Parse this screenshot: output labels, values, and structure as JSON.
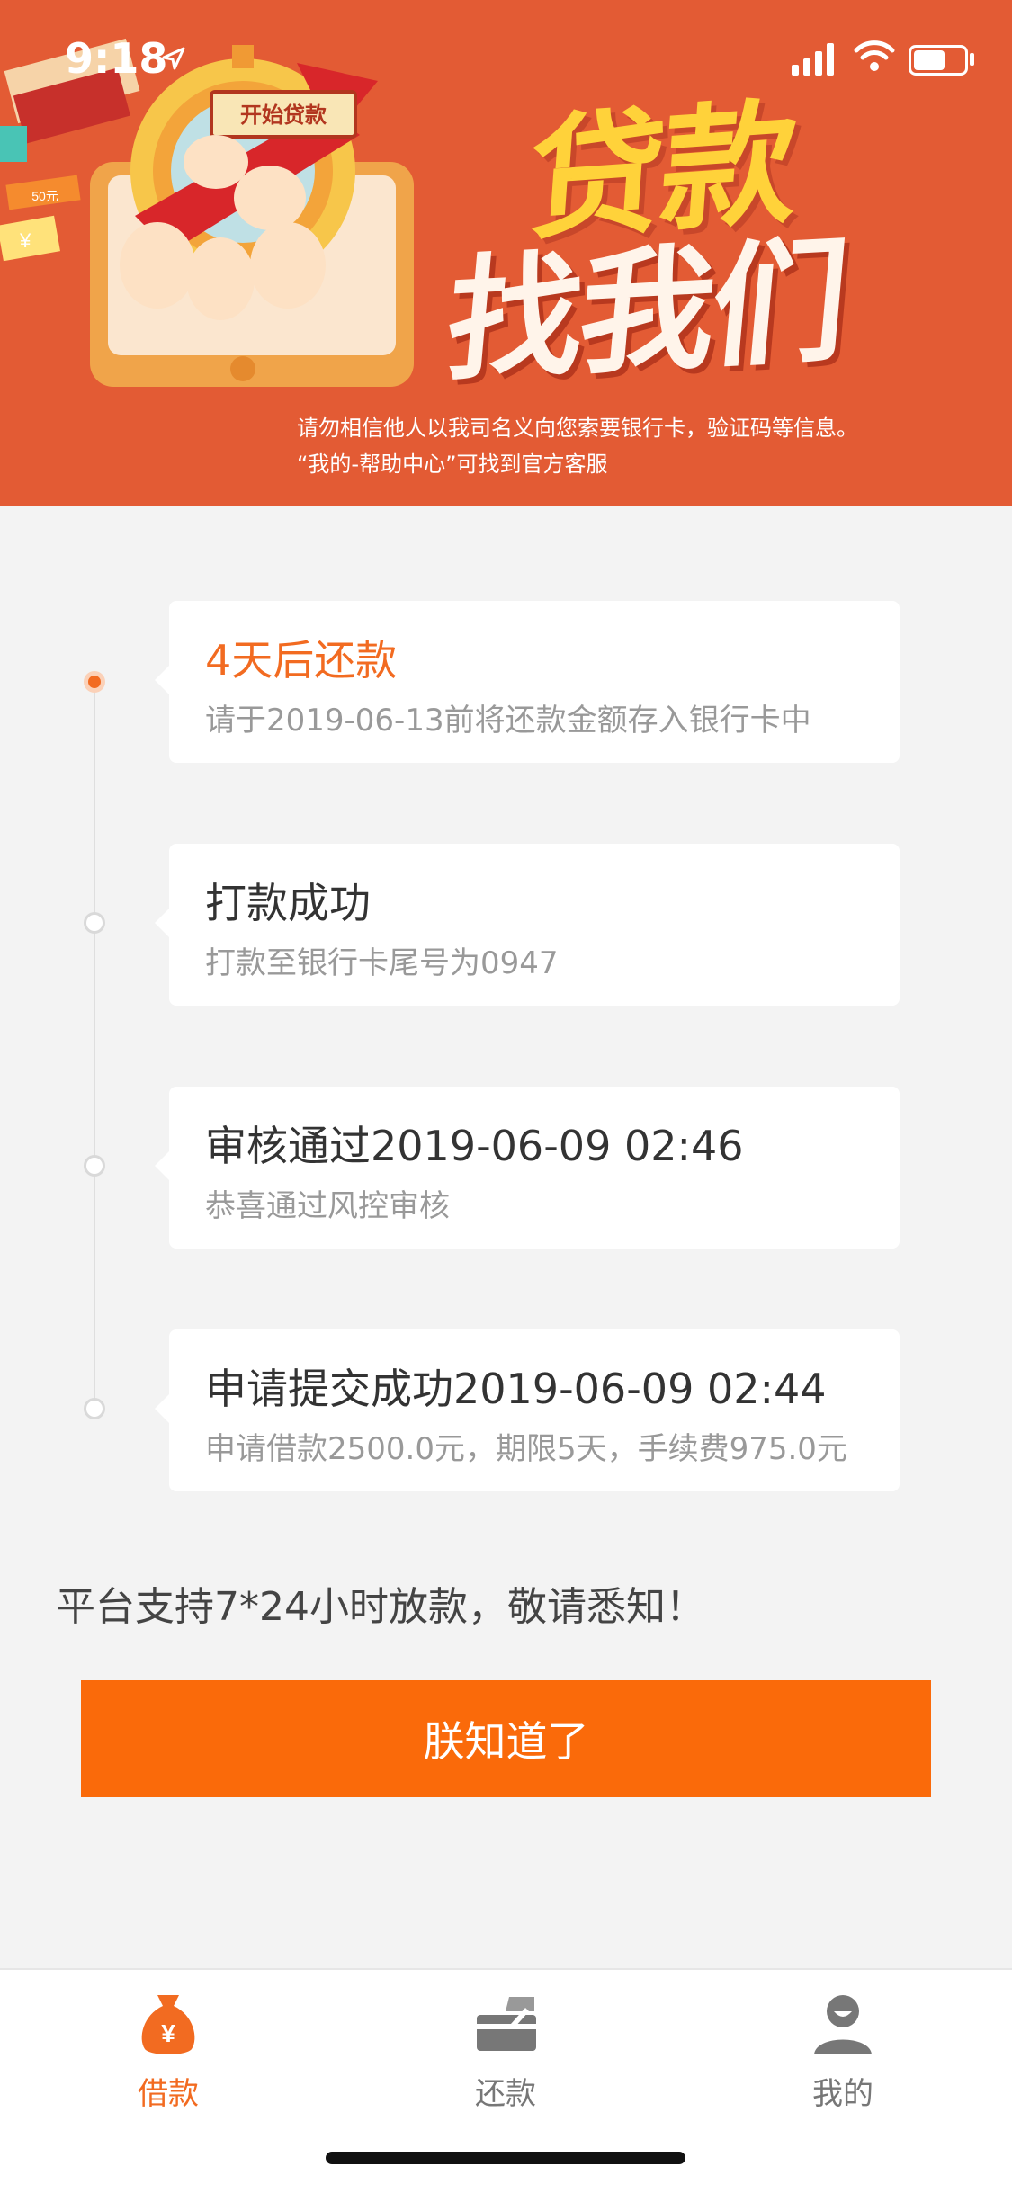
{
  "status_bar": {
    "time": "9:18"
  },
  "banner": {
    "badge": "开始贷款",
    "coupon": "50元",
    "yen": "¥",
    "title_line1": "贷款",
    "title_line2": "找我们",
    "notice_line1": "请勿相信他人以我司名义向您索要银行卡，验证码等信息。",
    "notice_line2": "“我的-帮助中心”可找到官方客服"
  },
  "timeline": [
    {
      "title": "4天后还款",
      "subtitle": "请于2019-06-13前将还款金额存入银行卡中",
      "active": true
    },
    {
      "title": "打款成功",
      "subtitle": "打款至银行卡尾号为0947",
      "active": false
    },
    {
      "title": "审核通过2019-06-09 02:46",
      "subtitle": "恭喜通过风控审核",
      "active": false
    },
    {
      "title": "申请提交成功2019-06-09 02:44",
      "subtitle": "申请借款2500.0元，期限5天，手续费975.0元",
      "active": false
    }
  ],
  "support_text": "平台支持7*24小时放款，敬请悉知！",
  "confirm_button": "朕知道了",
  "tabbar": {
    "items": [
      {
        "label": "借款",
        "icon": "money-bag-icon",
        "active": true
      },
      {
        "label": "还款",
        "icon": "card-pen-icon",
        "active": false
      },
      {
        "label": "我的",
        "icon": "user-icon",
        "active": false
      }
    ]
  },
  "colors": {
    "accent": "#fa6a0a",
    "banner": "#e35b34",
    "title_yellow": "#ffd23a"
  }
}
